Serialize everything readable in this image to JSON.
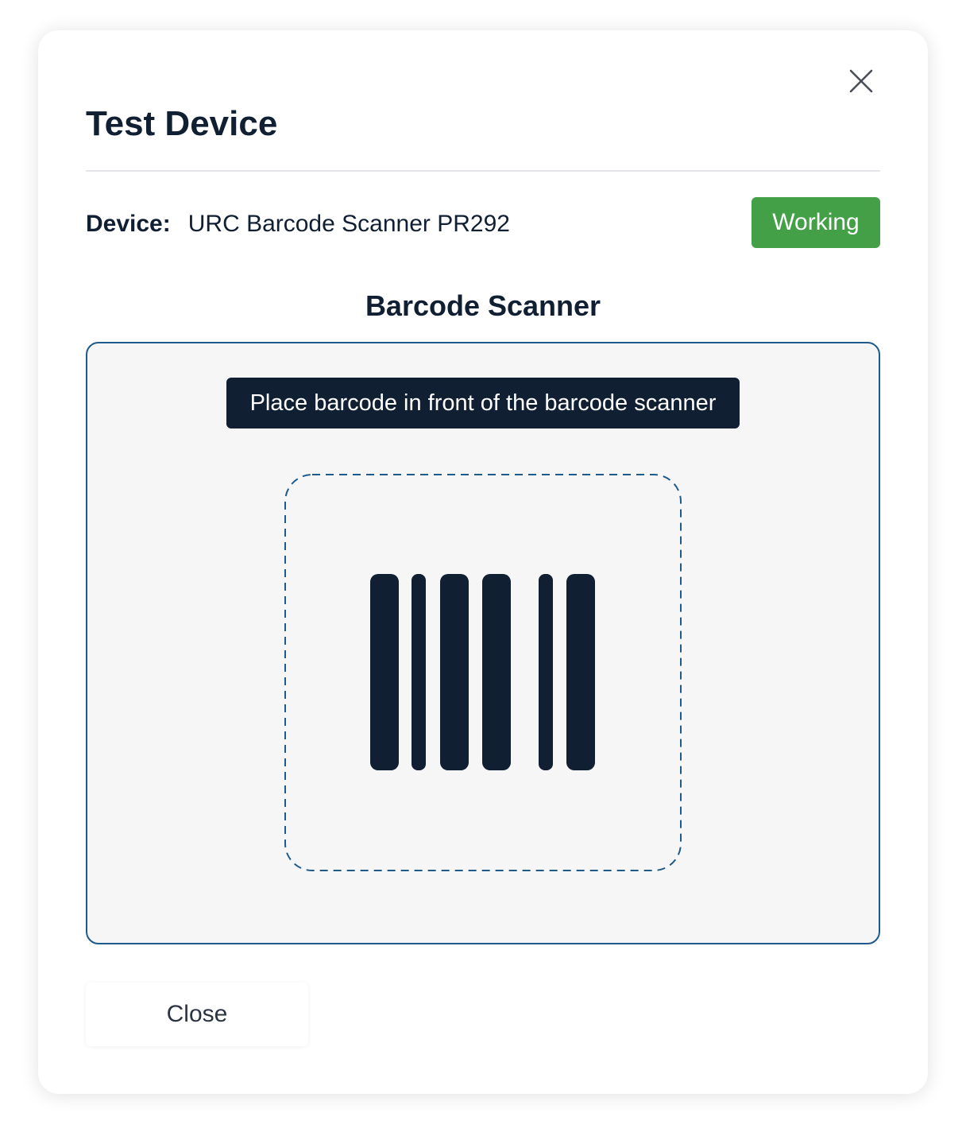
{
  "dialog": {
    "title": "Test Device",
    "close_icon": "close-icon"
  },
  "device": {
    "label": "Device:",
    "name": "URC Barcode Scanner PR292",
    "status": "Working",
    "status_color": "#43a047"
  },
  "scanner": {
    "title": "Barcode Scanner",
    "instruction": "Place barcode in front of the barcode scanner",
    "icon": "barcode-icon",
    "border_color": "#1e5a8c",
    "bar_color": "#111f33"
  },
  "footer": {
    "close_label": "Close"
  }
}
